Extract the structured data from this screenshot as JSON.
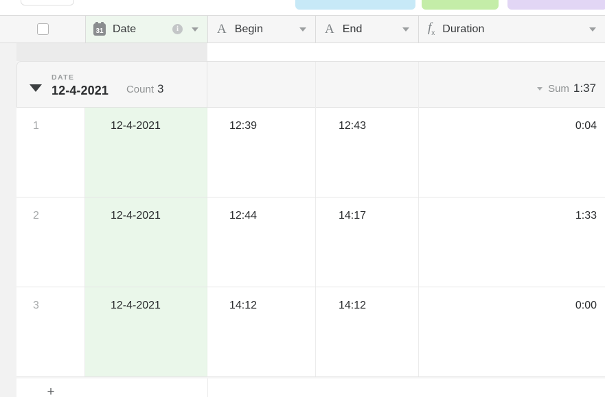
{
  "tabs": [
    {
      "name": "active-tab",
      "color": "#ffffff"
    },
    {
      "name": "tab-blue",
      "color": "#c7e9f7"
    },
    {
      "name": "tab-green",
      "color": "#c4eda8"
    },
    {
      "name": "tab-purple",
      "color": "#e2d6f5"
    }
  ],
  "columns": [
    {
      "key": "date",
      "label": "Date",
      "icon": "calendar-icon",
      "icon_text": "31",
      "has_info": true,
      "has_menu": true
    },
    {
      "key": "begin",
      "label": "Begin",
      "icon": "text-field-icon",
      "icon_text": "A",
      "has_info": false,
      "has_menu": true
    },
    {
      "key": "end",
      "label": "End",
      "icon": "text-field-icon",
      "icon_text": "A",
      "has_info": false,
      "has_menu": true
    },
    {
      "key": "duration",
      "label": "Duration",
      "icon": "formula-icon",
      "icon_text": "fx",
      "has_info": false,
      "has_menu": true
    }
  ],
  "select_all": {
    "checked": false
  },
  "group": {
    "field_label": "DATE",
    "value": "12-4-2021",
    "count_label": "Count",
    "count_value": "3",
    "summary_label": "Sum",
    "summary_value": "1:37",
    "expanded": true
  },
  "rows": [
    {
      "index": "1",
      "date": "12-4-2021",
      "begin": "12:39",
      "end": "12:43",
      "duration": "0:04"
    },
    {
      "index": "2",
      "date": "12-4-2021",
      "begin": "12:44",
      "end": "14:17",
      "duration": "1:33"
    },
    {
      "index": "3",
      "date": "12-4-2021",
      "begin": "14:12",
      "end": "14:12",
      "duration": "0:00"
    }
  ],
  "add_row": {
    "label": "+"
  },
  "colors": {
    "date_cell_background": "#eaf7ea",
    "header_background": "#f6f6f6",
    "group_band": "#ebebeb",
    "grid_line": "#e6e6e6"
  }
}
